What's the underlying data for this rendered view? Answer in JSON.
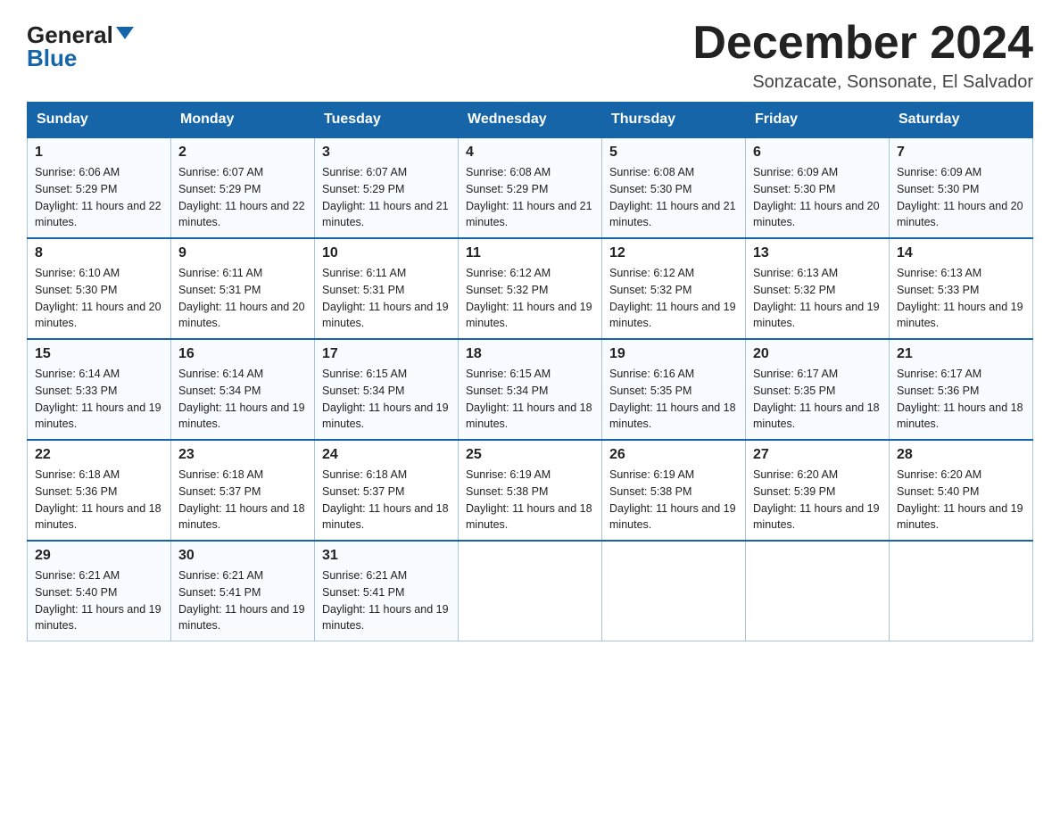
{
  "header": {
    "logo": {
      "general": "General",
      "blue": "Blue",
      "arrow": "▼"
    },
    "title": "December 2024",
    "subtitle": "Sonzacate, Sonsonate, El Salvador"
  },
  "days": [
    "Sunday",
    "Monday",
    "Tuesday",
    "Wednesday",
    "Thursday",
    "Friday",
    "Saturday"
  ],
  "weeks": [
    [
      {
        "day": "1",
        "sunrise": "6:06 AM",
        "sunset": "5:29 PM",
        "daylight": "11 hours and 22 minutes."
      },
      {
        "day": "2",
        "sunrise": "6:07 AM",
        "sunset": "5:29 PM",
        "daylight": "11 hours and 22 minutes."
      },
      {
        "day": "3",
        "sunrise": "6:07 AM",
        "sunset": "5:29 PM",
        "daylight": "11 hours and 21 minutes."
      },
      {
        "day": "4",
        "sunrise": "6:08 AM",
        "sunset": "5:29 PM",
        "daylight": "11 hours and 21 minutes."
      },
      {
        "day": "5",
        "sunrise": "6:08 AM",
        "sunset": "5:30 PM",
        "daylight": "11 hours and 21 minutes."
      },
      {
        "day": "6",
        "sunrise": "6:09 AM",
        "sunset": "5:30 PM",
        "daylight": "11 hours and 20 minutes."
      },
      {
        "day": "7",
        "sunrise": "6:09 AM",
        "sunset": "5:30 PM",
        "daylight": "11 hours and 20 minutes."
      }
    ],
    [
      {
        "day": "8",
        "sunrise": "6:10 AM",
        "sunset": "5:30 PM",
        "daylight": "11 hours and 20 minutes."
      },
      {
        "day": "9",
        "sunrise": "6:11 AM",
        "sunset": "5:31 PM",
        "daylight": "11 hours and 20 minutes."
      },
      {
        "day": "10",
        "sunrise": "6:11 AM",
        "sunset": "5:31 PM",
        "daylight": "11 hours and 19 minutes."
      },
      {
        "day": "11",
        "sunrise": "6:12 AM",
        "sunset": "5:32 PM",
        "daylight": "11 hours and 19 minutes."
      },
      {
        "day": "12",
        "sunrise": "6:12 AM",
        "sunset": "5:32 PM",
        "daylight": "11 hours and 19 minutes."
      },
      {
        "day": "13",
        "sunrise": "6:13 AM",
        "sunset": "5:32 PM",
        "daylight": "11 hours and 19 minutes."
      },
      {
        "day": "14",
        "sunrise": "6:13 AM",
        "sunset": "5:33 PM",
        "daylight": "11 hours and 19 minutes."
      }
    ],
    [
      {
        "day": "15",
        "sunrise": "6:14 AM",
        "sunset": "5:33 PM",
        "daylight": "11 hours and 19 minutes."
      },
      {
        "day": "16",
        "sunrise": "6:14 AM",
        "sunset": "5:34 PM",
        "daylight": "11 hours and 19 minutes."
      },
      {
        "day": "17",
        "sunrise": "6:15 AM",
        "sunset": "5:34 PM",
        "daylight": "11 hours and 19 minutes."
      },
      {
        "day": "18",
        "sunrise": "6:15 AM",
        "sunset": "5:34 PM",
        "daylight": "11 hours and 18 minutes."
      },
      {
        "day": "19",
        "sunrise": "6:16 AM",
        "sunset": "5:35 PM",
        "daylight": "11 hours and 18 minutes."
      },
      {
        "day": "20",
        "sunrise": "6:17 AM",
        "sunset": "5:35 PM",
        "daylight": "11 hours and 18 minutes."
      },
      {
        "day": "21",
        "sunrise": "6:17 AM",
        "sunset": "5:36 PM",
        "daylight": "11 hours and 18 minutes."
      }
    ],
    [
      {
        "day": "22",
        "sunrise": "6:18 AM",
        "sunset": "5:36 PM",
        "daylight": "11 hours and 18 minutes."
      },
      {
        "day": "23",
        "sunrise": "6:18 AM",
        "sunset": "5:37 PM",
        "daylight": "11 hours and 18 minutes."
      },
      {
        "day": "24",
        "sunrise": "6:18 AM",
        "sunset": "5:37 PM",
        "daylight": "11 hours and 18 minutes."
      },
      {
        "day": "25",
        "sunrise": "6:19 AM",
        "sunset": "5:38 PM",
        "daylight": "11 hours and 18 minutes."
      },
      {
        "day": "26",
        "sunrise": "6:19 AM",
        "sunset": "5:38 PM",
        "daylight": "11 hours and 19 minutes."
      },
      {
        "day": "27",
        "sunrise": "6:20 AM",
        "sunset": "5:39 PM",
        "daylight": "11 hours and 19 minutes."
      },
      {
        "day": "28",
        "sunrise": "6:20 AM",
        "sunset": "5:40 PM",
        "daylight": "11 hours and 19 minutes."
      }
    ],
    [
      {
        "day": "29",
        "sunrise": "6:21 AM",
        "sunset": "5:40 PM",
        "daylight": "11 hours and 19 minutes."
      },
      {
        "day": "30",
        "sunrise": "6:21 AM",
        "sunset": "5:41 PM",
        "daylight": "11 hours and 19 minutes."
      },
      {
        "day": "31",
        "sunrise": "6:21 AM",
        "sunset": "5:41 PM",
        "daylight": "11 hours and 19 minutes."
      },
      null,
      null,
      null,
      null
    ]
  ],
  "labels": {
    "sunrise": "Sunrise:",
    "sunset": "Sunset:",
    "daylight": "Daylight:"
  }
}
